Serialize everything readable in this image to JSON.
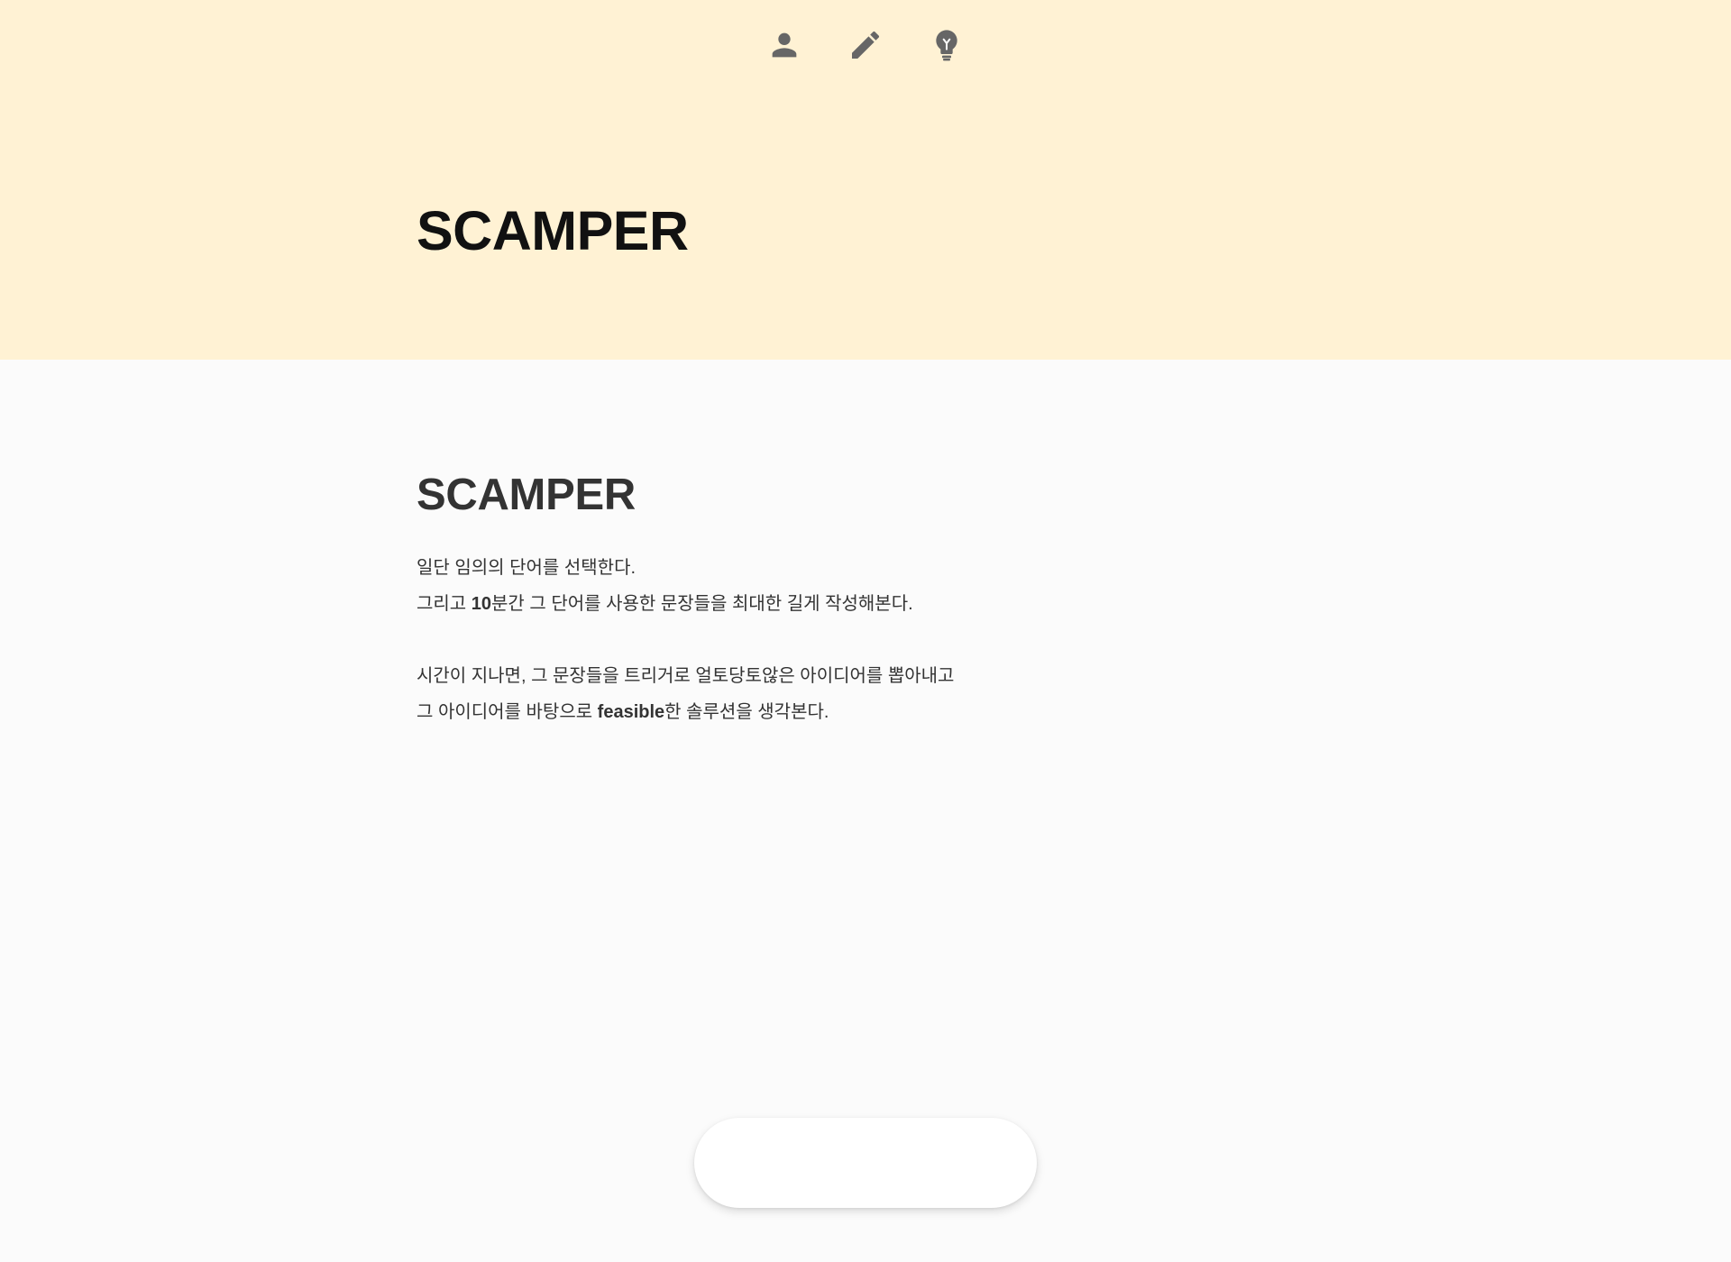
{
  "header": {
    "title": "SCAMPER",
    "background": "#fff2d4"
  },
  "article": {
    "title": "SCAMPER",
    "paragraph1": {
      "line1": "일단 임의의 단어를 선택한다.",
      "line2_pre": "그리고 ",
      "line2_bold": "10",
      "line2_post": "분간 그 단어를 사용한 문장들을 최대한 길게 작성해본다."
    },
    "paragraph2": {
      "line1": "시간이 지나면, 그 문장들을 트리거로 얼토당토않은 아이디어를 뽑아내고",
      "line2_pre": "그 아이디어를 바탕으로 ",
      "line2_bold": "feasible",
      "line2_post": "한 솔루션을 생각본다."
    }
  },
  "bottom_nav": {
    "items": [
      {
        "icon": "person-icon",
        "name": "profile"
      },
      {
        "icon": "pencil-icon",
        "name": "edit"
      },
      {
        "icon": "lightbulb-icon",
        "name": "idea"
      }
    ],
    "icon_color": "#666666"
  }
}
